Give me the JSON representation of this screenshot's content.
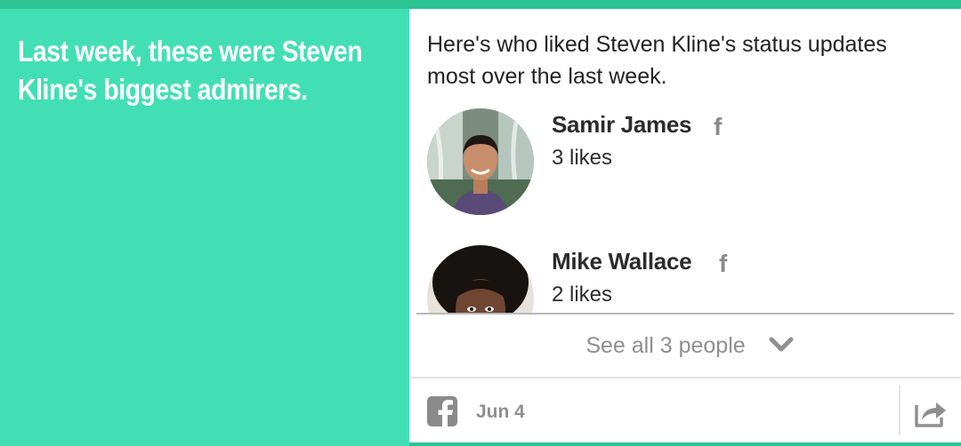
{
  "headline": "Last week, these were Steven Kline's biggest admirers.",
  "intro": "Here's who liked Steven Kline's status updates most over the last week.",
  "people": [
    {
      "name": "Samir James",
      "likes": "3 likes",
      "source_icon": "facebook-f-icon"
    },
    {
      "name": "Mike Wallace",
      "likes": "2 likes",
      "source_icon": "facebook-f-icon"
    }
  ],
  "see_all": {
    "label": "See all 3 people",
    "icon": "chevron-down-icon"
  },
  "footer": {
    "source_icon": "facebook-square-icon",
    "date": "Jun 4",
    "share_icon": "share-icon"
  },
  "colors": {
    "accent": "#43dfb4",
    "accent_dark": "#2cc492",
    "text": "#2b2b2b",
    "muted": "#8f8f8f"
  }
}
